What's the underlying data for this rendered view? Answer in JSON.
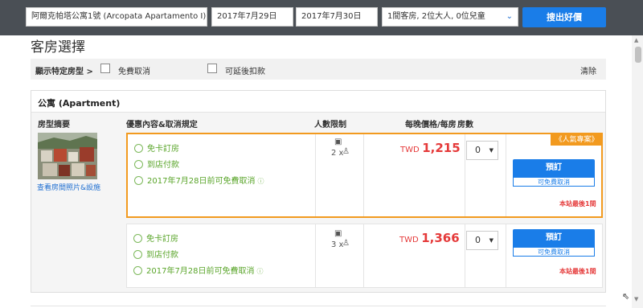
{
  "search": {
    "hotel": "阿爾克帕塔公寓1號 (Arcopata Apartamento I)",
    "checkin": "2017年7月29日",
    "checkout": "2017年7月30日",
    "guests": "1間客房, 2位大人, 0位兒童",
    "button": "搜出好價"
  },
  "page_title": "客房選擇",
  "filters": {
    "label": "顯示特定房型 >",
    "option1": "免費取消",
    "option2": "可延後扣款",
    "clear": "清除"
  },
  "room": {
    "title": "公寓 (Apartment)",
    "columns": {
      "summary": "房型摘要",
      "offer": "優惠內容&取消規定",
      "capacity": "人數限制",
      "price": "每晚價格/每房",
      "rooms": "房數"
    },
    "photo_link": "查看房間照片&設施",
    "offers": [
      {
        "benefits": [
          "免卡訂房",
          "到店付款",
          "2017年7月28日前可免費取消"
        ],
        "capacity": "2 x",
        "currency": "TWD",
        "price": "1,215",
        "qty": "0",
        "book": "預訂",
        "free_cancel": "可免費取消",
        "last_room": "本站最後1間",
        "badge": "《人氣專案》"
      },
      {
        "benefits": [
          "免卡訂房",
          "到店付款",
          "2017年7月28日前可免費取消"
        ],
        "capacity": "3 x",
        "currency": "TWD",
        "price": "1,366",
        "qty": "0",
        "book": "預訂",
        "free_cancel": "可免費取消",
        "last_room": "本站最後1間"
      }
    ]
  },
  "colors": {
    "accent": "#1a7de8",
    "price": "#e53a3a",
    "highlight": "#f29a1f",
    "benefit": "#5aa52a"
  }
}
